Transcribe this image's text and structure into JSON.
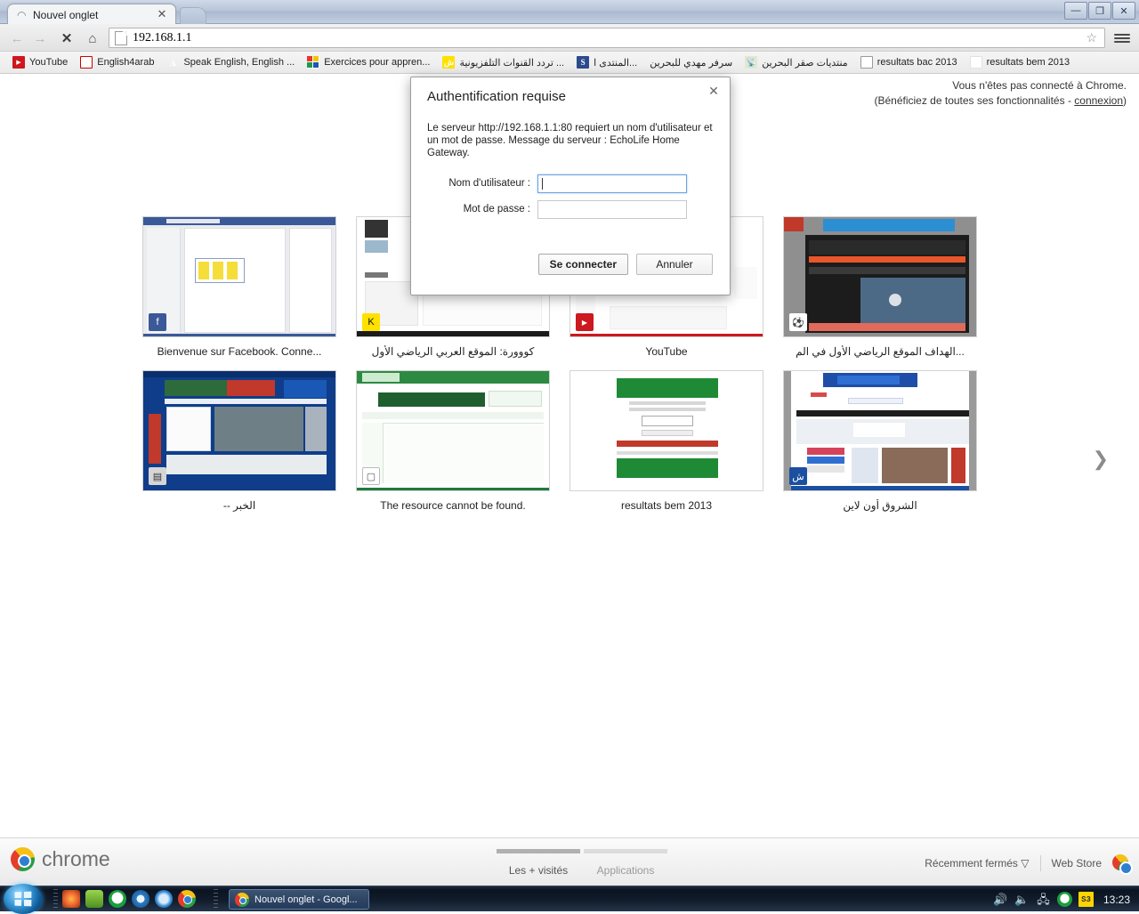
{
  "window": {
    "minimize_label": "—",
    "maximize_label": "❐",
    "close_label": "✕"
  },
  "tab": {
    "title": "Nouvel onglet",
    "close_label": "✕"
  },
  "toolbar": {
    "back_icon": "←",
    "forward_icon": "→",
    "stop_icon": "✕",
    "home_icon": "⌂",
    "url": "192.168.1.1",
    "star_icon": "☆"
  },
  "bookmarks": [
    {
      "label": "YouTube",
      "icon": "youtube-icon"
    },
    {
      "label": "English4arab",
      "icon": "letter-e-icon"
    },
    {
      "label": "Speak English, English ...",
      "icon": "triangle-icon"
    },
    {
      "label": "Exercices pour appren...",
      "icon": "color-grid-icon"
    },
    {
      "label": "تردد القنوات التلفزيونية ...",
      "icon": "arabic-yellow-icon"
    },
    {
      "label": "المنتدى ا... ",
      "icon": "letter-s-icon"
    },
    {
      "label": "سرفر مهدي للبحرين",
      "icon": "bahrain-forum-icon"
    },
    {
      "label": "منتديات صقر البحرين",
      "icon": "antenna-icon"
    },
    {
      "label": "resultats bac 2013",
      "icon": "document-icon"
    },
    {
      "label": "resultats bem 2013",
      "icon": "blank-icon"
    }
  ],
  "ntp": {
    "signin_line1": "Vous n'êtes pas connecté à Chrome.",
    "signin_line2_prefix": "(Bénéficiez de toutes ses fonctionnalités - ",
    "signin_link": "connexion",
    "signin_line2_suffix": ")",
    "next_arrow": "❯",
    "tiles": [
      {
        "title": "Bienvenue sur Facebook. Conne...",
        "badge": "f",
        "accent": "#3b5998"
      },
      {
        "title": "كووورة: الموقع العربي الرياضي الأول",
        "badge": "K",
        "accent": "#000000"
      },
      {
        "title": "YouTube",
        "badge": "▶",
        "accent": "#cc181e"
      },
      {
        "title": "الهداف الموقع الرياضي الأول في الم...",
        "badge": "⚽",
        "accent": "#ffffff"
      },
      {
        "title": "-- الخبر",
        "badge": "▤",
        "accent": "#0f3d8a"
      },
      {
        "title": "The resource cannot be found.",
        "badge": "▢",
        "accent": "#1f7a3d"
      },
      {
        "title": "resultats bem 2013",
        "badge": "",
        "accent": "#ffffff"
      },
      {
        "title": "الشروق أون لاين",
        "badge": "ش",
        "accent": "#1b4fa0"
      }
    ],
    "bottom": {
      "brand": "chrome",
      "tab_most_visited": "Les + visités",
      "tab_apps": "Applications",
      "recently_closed": "Récemment fermés",
      "recently_closed_caret": "▽",
      "web_store": "Web Store"
    }
  },
  "dialog": {
    "title": "Authentification requise",
    "close_label": "✕",
    "message": "Le serveur http://192.168.1.1:80 requiert un nom d'utilisateur et un mot de passe. Message du serveur : EchoLife Home Gateway.",
    "username_label": "Nom d'utilisateur :",
    "username_value": "",
    "password_label": "Mot de passe :",
    "password_value": "",
    "connect_button": "Se connecter",
    "cancel_button": "Annuler"
  },
  "taskbar": {
    "start_label": "Démarrer",
    "quick_launch": [
      "firefox-icon",
      "messenger-icon",
      "utorrent-icon",
      "media-player-icon",
      "internet-explorer-icon",
      "chrome-icon"
    ],
    "task_items": [
      {
        "label": "Nouvel onglet - Googl...",
        "icon": "chrome-icon"
      }
    ],
    "tray": [
      "volume-icon",
      "speaker-icon",
      "network-error-icon",
      "utorrent-icon",
      "s3-icon"
    ],
    "clock": "13:23"
  }
}
